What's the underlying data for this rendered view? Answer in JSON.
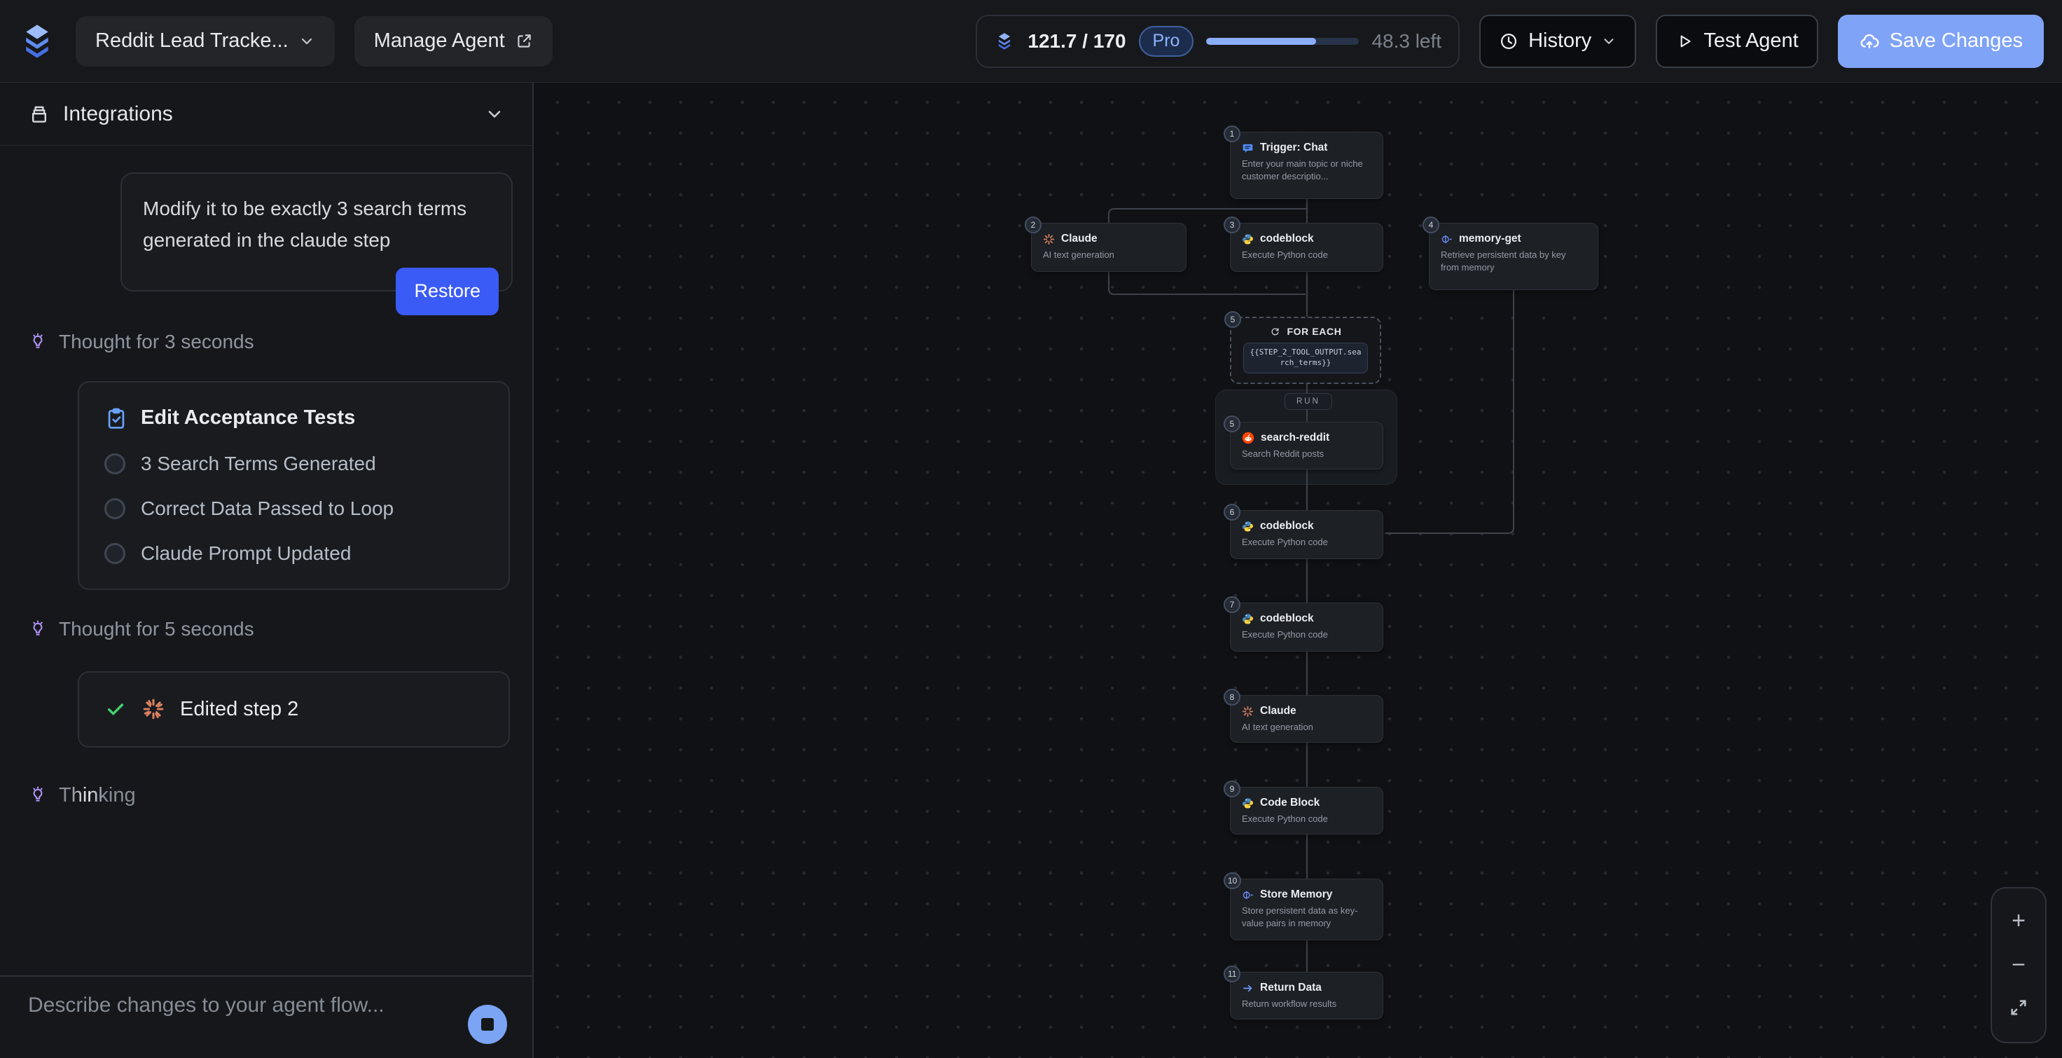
{
  "topbar": {
    "agent_name": "Reddit Lead Tracke...",
    "manage_label": "Manage Agent",
    "usage": {
      "display": "121.7 / 170",
      "plan": "Pro",
      "remaining": "48.3 left",
      "progress_style": "width:71.6%"
    },
    "history_label": "History",
    "test_label": "Test Agent",
    "save_label": "Save Changes"
  },
  "sidebar": {
    "integrations_title": "Integrations",
    "user_message": "Modify it to be exactly 3 search terms generated in the claude step",
    "restore_label": "Restore",
    "thought_3s": "Thought for 3 seconds",
    "acceptance": {
      "title": "Edit Acceptance Tests",
      "items": [
        "3 Search Terms Generated",
        "Correct Data Passed to Loop",
        "Claude Prompt Updated"
      ]
    },
    "thought_5s": "Thought for 5 seconds",
    "edited_step": "Edited step 2",
    "thinking_label": "Thinking",
    "input_placeholder": "Describe changes to your agent flow..."
  },
  "canvas": {
    "for_each": {
      "num": "5",
      "label": "FOR EACH",
      "expression": "{{STEP_2_TOOL_OUTPUT.search_terms}}",
      "run_label": "RUN"
    },
    "nodes": [
      {
        "num": "1",
        "title": "Trigger: Chat",
        "subtitle": "Enter your main topic or niche customer descriptio..."
      },
      {
        "num": "2",
        "title": "Claude",
        "subtitle": "AI text generation"
      },
      {
        "num": "3",
        "title": "codeblock",
        "subtitle": "Execute Python code"
      },
      {
        "num": "4",
        "title": "memory-get",
        "subtitle": "Retrieve persistent data by key from memory"
      },
      {
        "num": "5",
        "title": "search-reddit",
        "subtitle": "Search Reddit posts"
      },
      {
        "num": "6",
        "title": "codeblock",
        "subtitle": "Execute Python code"
      },
      {
        "num": "7",
        "title": "codeblock",
        "subtitle": "Execute Python code"
      },
      {
        "num": "8",
        "title": "Claude",
        "subtitle": "AI text generation"
      },
      {
        "num": "9",
        "title": "Code Block",
        "subtitle": "Execute Python code"
      },
      {
        "num": "10",
        "title": "Store Memory",
        "subtitle": "Store persistent data as key-value pairs in memory"
      },
      {
        "num": "11",
        "title": "Return Data",
        "subtitle": "Return workflow results"
      }
    ],
    "zoom_controls": {
      "plus": "+",
      "minus": "−"
    }
  },
  "colors": {
    "accent_blue": "#3b5bf6",
    "save_blue": "#7fa3f6",
    "claude_orange": "#d8805f",
    "reddit_orange": "#ff4500",
    "python_blue": "#4b8bbe",
    "python_yellow": "#ffd43b",
    "purple": "#b094f8",
    "green": "#45d06c"
  }
}
